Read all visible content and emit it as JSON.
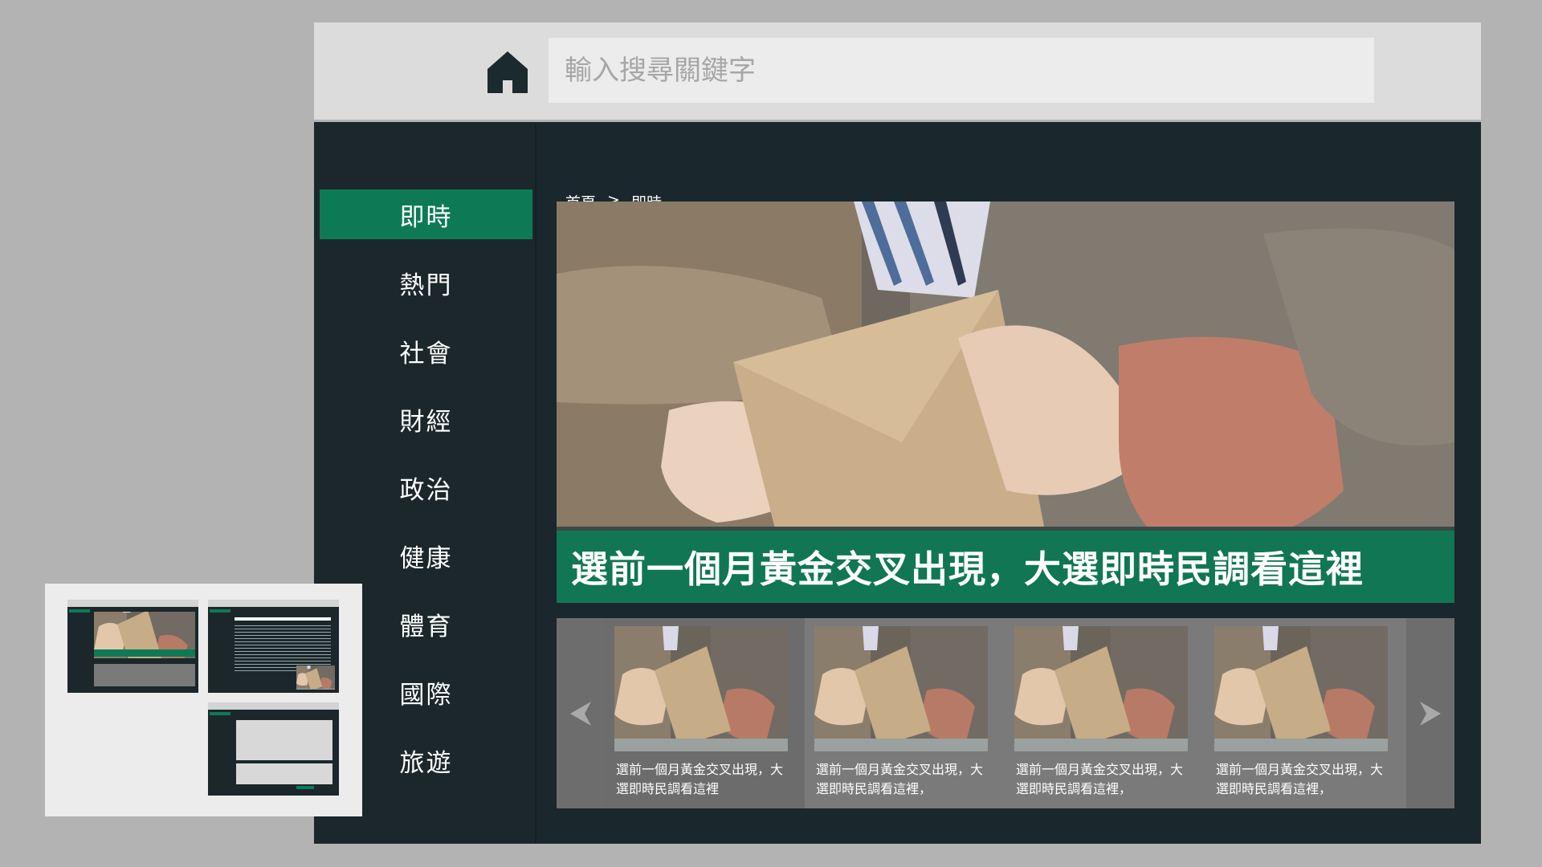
{
  "search": {
    "placeholder": "輸入搜尋關鍵字"
  },
  "sidebar": {
    "items": [
      {
        "label": "即時",
        "active": true
      },
      {
        "label": "熱門"
      },
      {
        "label": "社會"
      },
      {
        "label": "財經"
      },
      {
        "label": "政治"
      },
      {
        "label": "健康"
      },
      {
        "label": "體育"
      },
      {
        "label": "國際"
      },
      {
        "label": "旅遊"
      }
    ]
  },
  "breadcrumb": {
    "home": "首頁",
    "separator": ">",
    "current": "即時"
  },
  "hero": {
    "caption": "選前一個月黃金交叉出現，大選即時民調看這裡"
  },
  "carousel": {
    "cards": [
      {
        "title": "選前一個月黃金交叉出現，大選即時民調看這裡"
      },
      {
        "title": "選前一個月黃金交叉出現，大選即時民調看這裡，"
      },
      {
        "title": "選前一個月黃金交叉出現，大選即時民調看這裡，"
      },
      {
        "title": "選前一個月黃金交叉出現，大選即時民調看這裡，"
      }
    ]
  },
  "colors": {
    "accent": "#0e7a55",
    "dark_bg": "#1b272b",
    "topbar": "#dcdcdc",
    "page_bg": "#b3b3b3"
  },
  "icons": {
    "home": "home-icon",
    "prev": "chevron-left-icon",
    "next": "chevron-right-icon"
  }
}
